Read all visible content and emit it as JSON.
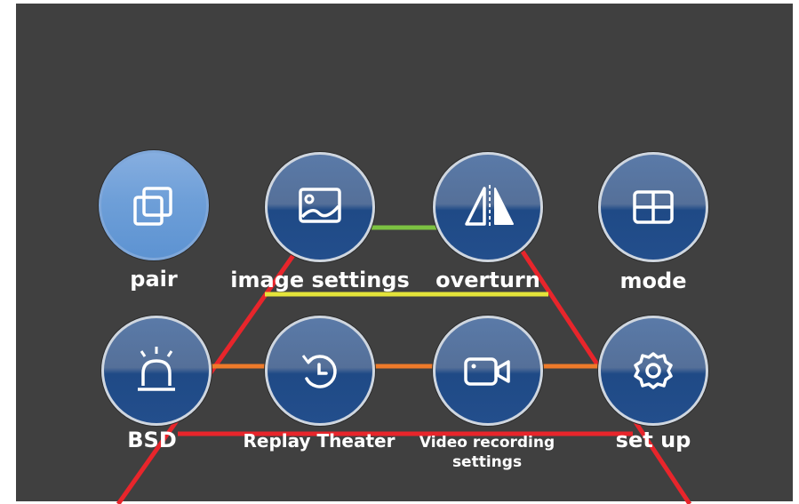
{
  "menu": {
    "items": [
      {
        "label": "pair",
        "icon": "pair-icon",
        "active": true
      },
      {
        "label": "image settings",
        "icon": "image-icon",
        "active": false
      },
      {
        "label": "overturn",
        "icon": "overturn-icon",
        "active": false
      },
      {
        "label": "mode",
        "icon": "grid-icon",
        "active": false
      },
      {
        "label": "BSD",
        "icon": "alarm-light-icon",
        "active": false
      },
      {
        "label": "Replay Theater",
        "icon": "replay-clock-icon",
        "active": false
      },
      {
        "label": "Video recording settings",
        "label_line1": "Video recording",
        "label_line2": "settings",
        "icon": "video-camera-icon",
        "active": false
      },
      {
        "label": "set up",
        "icon": "gear-icon",
        "active": false
      }
    ]
  },
  "colors": {
    "background": "#404040",
    "tile_active": "#6e9fd8",
    "tile_normal": "#1f4a86",
    "guide_red": "#e8252b",
    "guide_yellow": "#e4e43a",
    "guide_green": "#7cc242",
    "guide_orange": "#ee7a2a"
  }
}
